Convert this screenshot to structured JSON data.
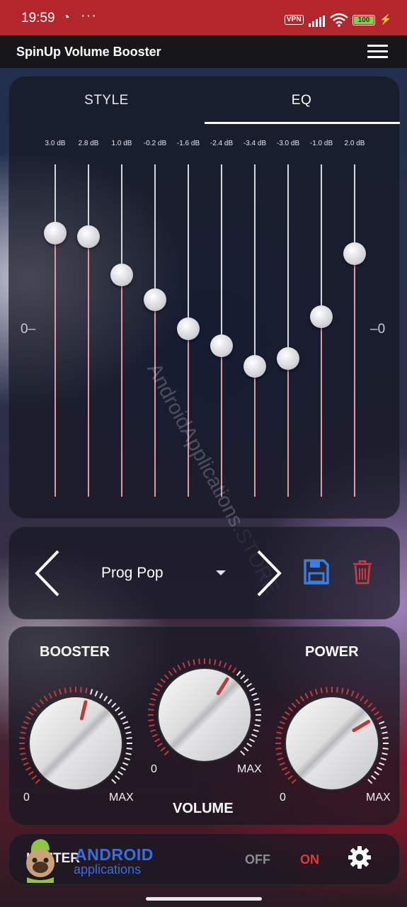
{
  "status_bar": {
    "time": "19:59",
    "dots": "···",
    "vpn": "VPN",
    "battery": "100"
  },
  "app_bar": {
    "title": "SpinUp Volume Booster",
    "menu_icon": "hamburger-menu-icon"
  },
  "tabs": [
    {
      "label": "STYLE",
      "selected": false
    },
    {
      "label": "EQ",
      "selected": true
    }
  ],
  "eq": {
    "zero_label_left": "0",
    "zero_label_right": "0",
    "bands": [
      {
        "label": "3.0 dB",
        "value": 3.0
      },
      {
        "label": "2.8 dB",
        "value": 2.8
      },
      {
        "label": "1.0 dB",
        "value": 1.0
      },
      {
        "label": "-0.2 dB",
        "value": -0.2
      },
      {
        "label": "-1.6 dB",
        "value": -1.6
      },
      {
        "label": "-2.4 dB",
        "value": -2.4
      },
      {
        "label": "-3.4 dB",
        "value": -3.4
      },
      {
        "label": "-3.0 dB",
        "value": -3.0
      },
      {
        "label": "-1.0 dB",
        "value": -1.0
      },
      {
        "label": "2.0 dB",
        "value": 2.0
      }
    ]
  },
  "preset": {
    "name": "Prog Pop",
    "save_icon": "floppy-disk-icon",
    "delete_icon": "trash-icon",
    "accent": "#3a7fe0",
    "delete_color": "#d23a3a"
  },
  "knobs": {
    "booster": {
      "label": "BOOSTER",
      "min": "0",
      "max": "MAX",
      "level": 0.55
    },
    "volume": {
      "label": "VOLUME",
      "min": "0",
      "max": "MAX",
      "level": 0.62
    },
    "power": {
      "label": "POWER",
      "min": "0",
      "max": "MAX",
      "level": 0.72
    }
  },
  "bottom": {
    "limiter": "LIMITER",
    "off": "OFF",
    "on": "ON",
    "on_selected": true,
    "settings_icon": "gear-icon",
    "on_color": "#e0393b"
  },
  "logo": {
    "line1": "ANDROID",
    "line2": "applications"
  },
  "watermark": "AndroidApplications.STORE"
}
